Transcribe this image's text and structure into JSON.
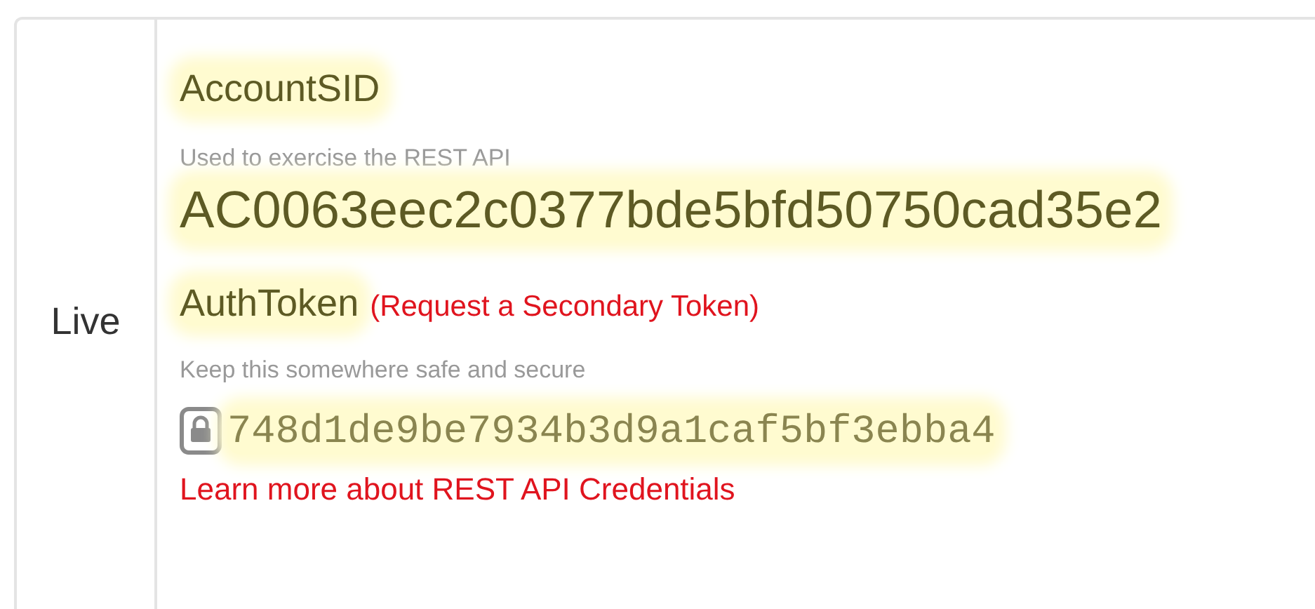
{
  "environment": {
    "label": "Live"
  },
  "account_sid": {
    "label": "AccountSID",
    "hint": "Used to exercise the REST API",
    "value": "AC0063eec2c0377bde5bfd50750cad35e2"
  },
  "auth_token": {
    "label": "AuthToken",
    "link": "(Request a Secondary Token)",
    "hint": "Keep this somewhere safe and secure",
    "value": "748d1de9be7934b3d9a1caf5bf3ebba4"
  },
  "help_link": "Learn more about REST API Credentials"
}
